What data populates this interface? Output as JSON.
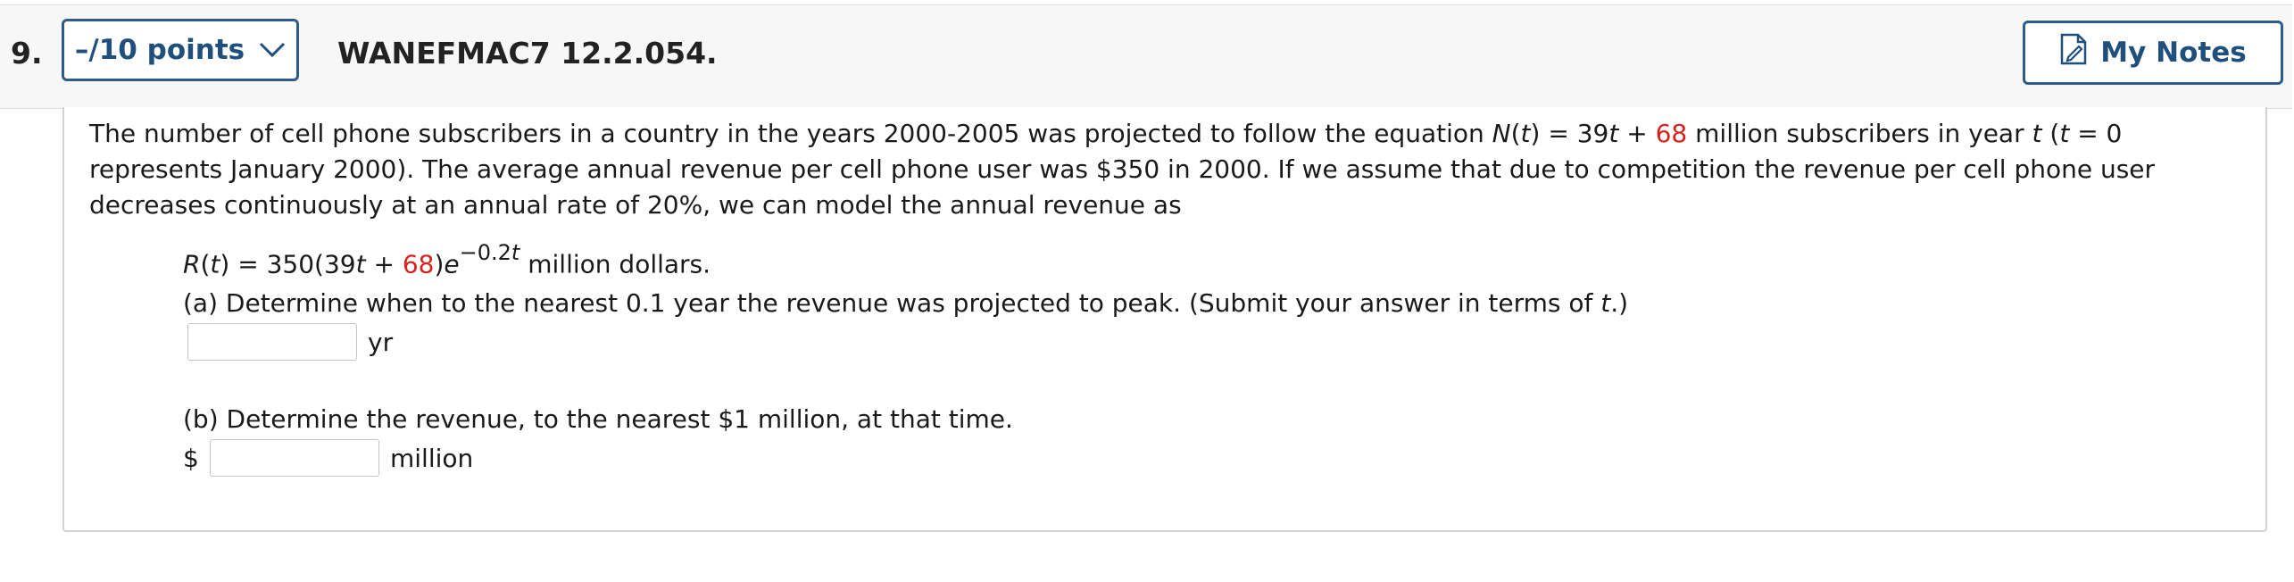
{
  "question": {
    "number": "9.",
    "points_label": "–/10 points",
    "id_label": "WANEFMAC7 12.2.054.",
    "notes_label": "My Notes"
  },
  "problem": {
    "p1_a": "The number of cell phone subscribers in a country in the years 2000-2005 was projected to follow the equation ",
    "p1_N": "N",
    "p1_b": "(",
    "p1_t1": "t",
    "p1_c": ") = 39",
    "p1_t2": "t",
    "p1_d": " + ",
    "p1_red": "68",
    "p1_e": " million subscribers in year ",
    "p1_t3": "t",
    "p1_f": " (",
    "p1_t4": "t",
    "p1_g": " = 0 represents January 2000). The average annual revenue per cell phone user was $350 in 2000. If we assume that due to competition the revenue per cell phone user decreases continuously at an annual rate of 20%, we can model the annual revenue as",
    "formula_R": "R",
    "formula_a": "(",
    "formula_t": "t",
    "formula_b": ") = 350(39",
    "formula_t2": "t",
    "formula_c": " + ",
    "formula_red": "68",
    "formula_d": ")",
    "formula_e": "e",
    "formula_exp": "−0.2",
    "formula_exp_t": "t",
    "formula_f": " million dollars.",
    "part_a_text": "(a) Determine when to the nearest 0.1 year the revenue was projected to peak. (Submit your answer in terms of ",
    "part_a_t": "t",
    "part_a_end": ".)",
    "part_a_value": "",
    "part_a_unit": "yr",
    "part_b_text": "(b) Determine the revenue, to the nearest $1 million, at that time.",
    "part_b_prefix": "$",
    "part_b_value": "",
    "part_b_unit": "million"
  },
  "colors": {
    "accent": "#2c5d8a",
    "highlight_red": "#d6231c"
  }
}
